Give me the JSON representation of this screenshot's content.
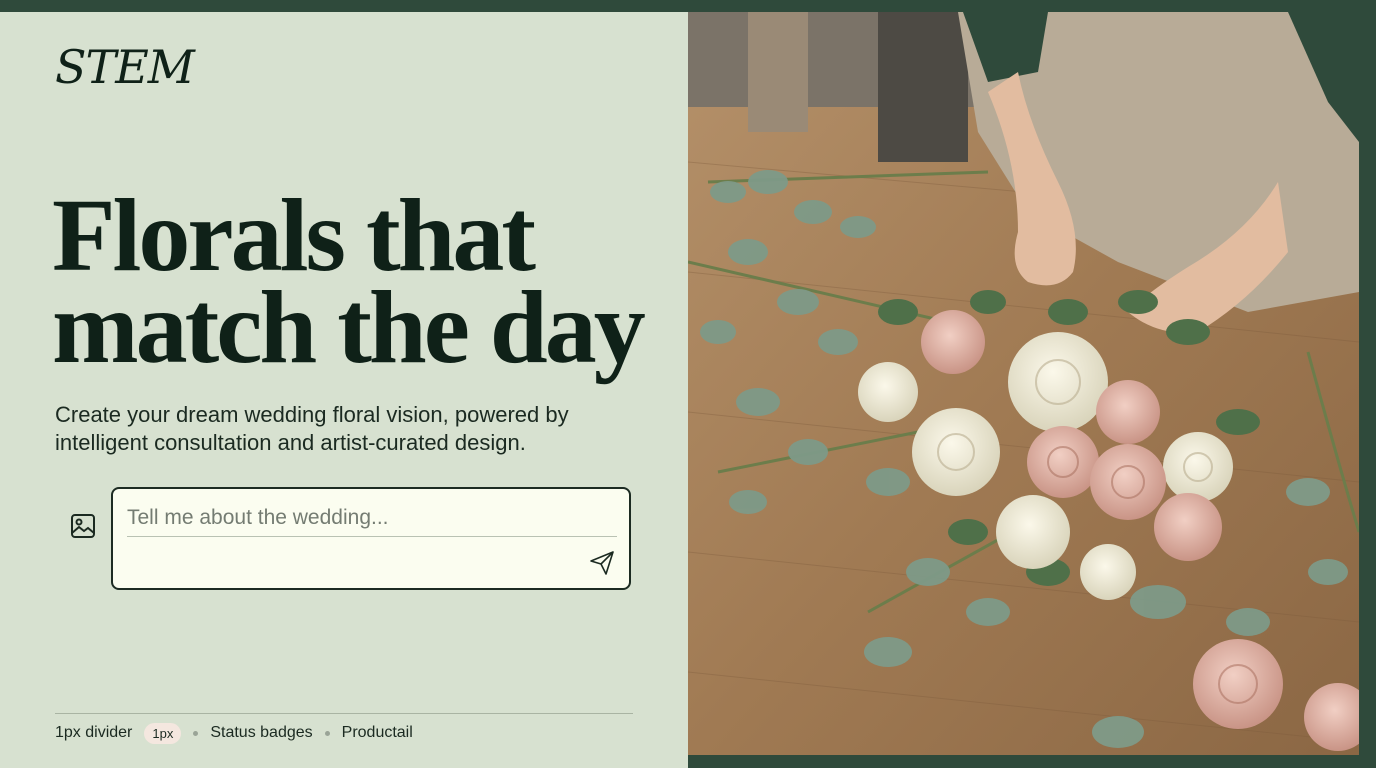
{
  "brand": {
    "logo": "STEM"
  },
  "hero": {
    "headline_line1": "Florals that",
    "headline_line2": "match the day",
    "subtext": "Create your dream wedding floral vision, powered by intelligent consultation and artist-curated design."
  },
  "composer": {
    "placeholder": "Tell me about the wedding...",
    "value": "",
    "image_icon": "image-icon",
    "send_icon": "send-icon"
  },
  "footer": {
    "item1": "1px divider",
    "badge": "1px",
    "item2": "Status badges",
    "item3": "Productail"
  },
  "colors": {
    "frame": "#2f4a3b",
    "panel_bg": "#d7e1d0",
    "ink": "#0f2118",
    "input_bg": "#fbfdf0",
    "badge_bg": "#f4e7df"
  }
}
